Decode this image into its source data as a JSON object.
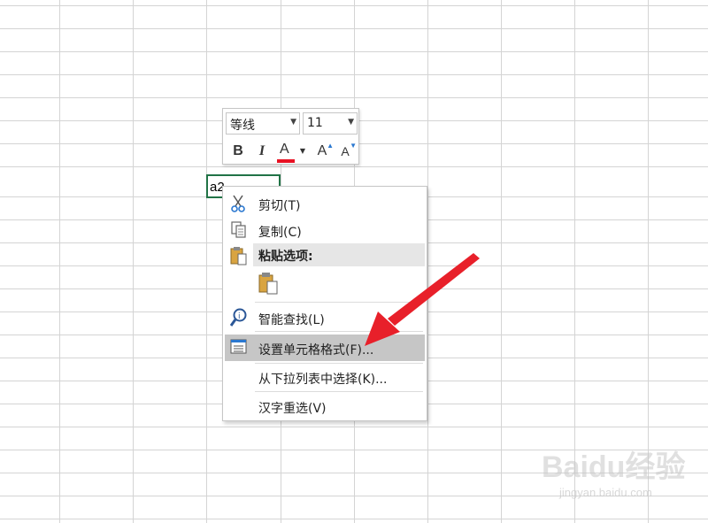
{
  "sheet": {
    "active_cell_value": "a2"
  },
  "mini_toolbar": {
    "font_name": "等线",
    "font_size": "11",
    "bold_label": "B",
    "italic_label": "I",
    "font_color_label": "A",
    "font_color": "#e81123",
    "grow_label": "A",
    "shrink_label": "A"
  },
  "context_menu": {
    "items": [
      {
        "label": "剪切(T)",
        "icon": "scissors-icon"
      },
      {
        "label": "复制(C)",
        "icon": "copy-icon"
      },
      {
        "label": "粘贴选项:",
        "icon": "paste-icon"
      },
      {
        "label": "智能查找(L)",
        "icon": "smart-lookup-icon"
      },
      {
        "label": "设置单元格格式(F)...",
        "icon": "format-cells-icon"
      },
      {
        "label": "从下拉列表中选择(K)...",
        "icon": ""
      },
      {
        "label": "汉字重选(V)",
        "icon": ""
      }
    ],
    "highlighted_index": 4
  },
  "annotation": {
    "arrow_color": "#e8202a"
  },
  "watermark": {
    "text": "Baidu经验",
    "sub": "jingyan.baidu.com"
  }
}
